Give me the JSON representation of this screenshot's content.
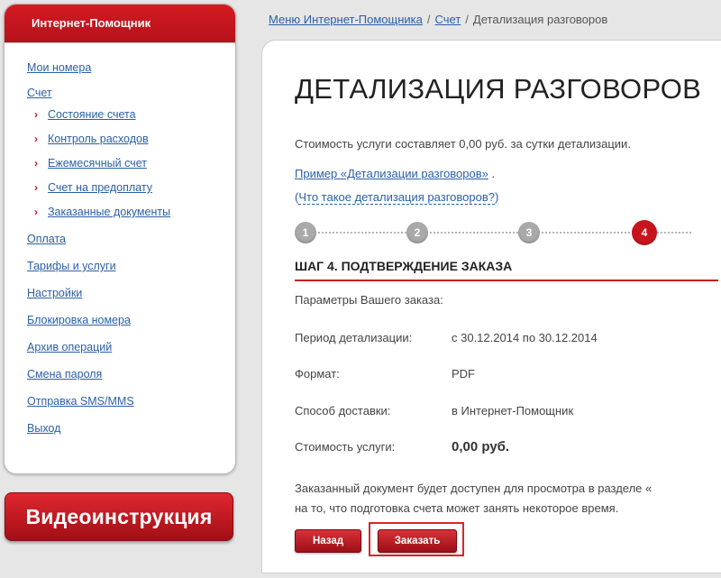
{
  "sidebar": {
    "title": "Интернет-Помощник",
    "items": [
      {
        "label": "Мои номера"
      },
      {
        "label": "Счет"
      },
      {
        "label": "Оплата"
      },
      {
        "label": "Тарифы и услуги"
      },
      {
        "label": "Настройки"
      },
      {
        "label": "Блокировка номера"
      },
      {
        "label": "Архив операций"
      },
      {
        "label": "Смена пароля"
      },
      {
        "label": "Отправка SMS/MMS"
      },
      {
        "label": "Выход"
      }
    ],
    "account_subitems": [
      {
        "label": "Состояние счета"
      },
      {
        "label": "Контроль расходов"
      },
      {
        "label": "Ежемесячный счет"
      },
      {
        "label": "Счет на предоплату"
      },
      {
        "label": "Заказанные документы"
      }
    ],
    "sub_marker": "›"
  },
  "video_banner": {
    "label": "Видеоинструкция"
  },
  "breadcrumb": {
    "items": [
      "Меню Интернет-Помощника",
      "Счет"
    ],
    "current": "Детализация разговоров",
    "separator": "/"
  },
  "main": {
    "title": "ДЕТАЛИЗАЦИЯ РАЗГОВОРОВ",
    "price_note": "Стоимость услуги составляет 0,00 руб. за сутки детализации.",
    "example_link": "Пример «Детализации разговоров»",
    "example_suffix": " .",
    "what_open": "(",
    "what_link": "Что такое детализация разговоров?",
    "what_close": ")",
    "steps": [
      "1",
      "2",
      "3",
      "4"
    ],
    "active_step": 4,
    "step_heading": "ШАГ 4. ПОДТВЕРЖДЕНИЕ ЗАКАЗА",
    "params_label": "Параметры Вашего заказа:",
    "order_rows": [
      {
        "label": "Период детализации:",
        "value": "с 30.12.2014 по 30.12.2014"
      },
      {
        "label": "Формат:",
        "value": "PDF"
      },
      {
        "label": "Способ доставки:",
        "value": "в Интернет-Помощник"
      },
      {
        "label": "Стоимость услуги:",
        "value": "0,00 руб."
      }
    ],
    "note_line1": "Заказанный документ будет доступен для просмотра в разделе «",
    "note_line2": "на то, что подготовка счета может занять некоторое время.",
    "back_button": "Назад",
    "order_button": "Заказать"
  },
  "colors": {
    "accent": "#c8151d",
    "link": "#2b5fa8",
    "inactive_step": "#a9a9a9"
  }
}
